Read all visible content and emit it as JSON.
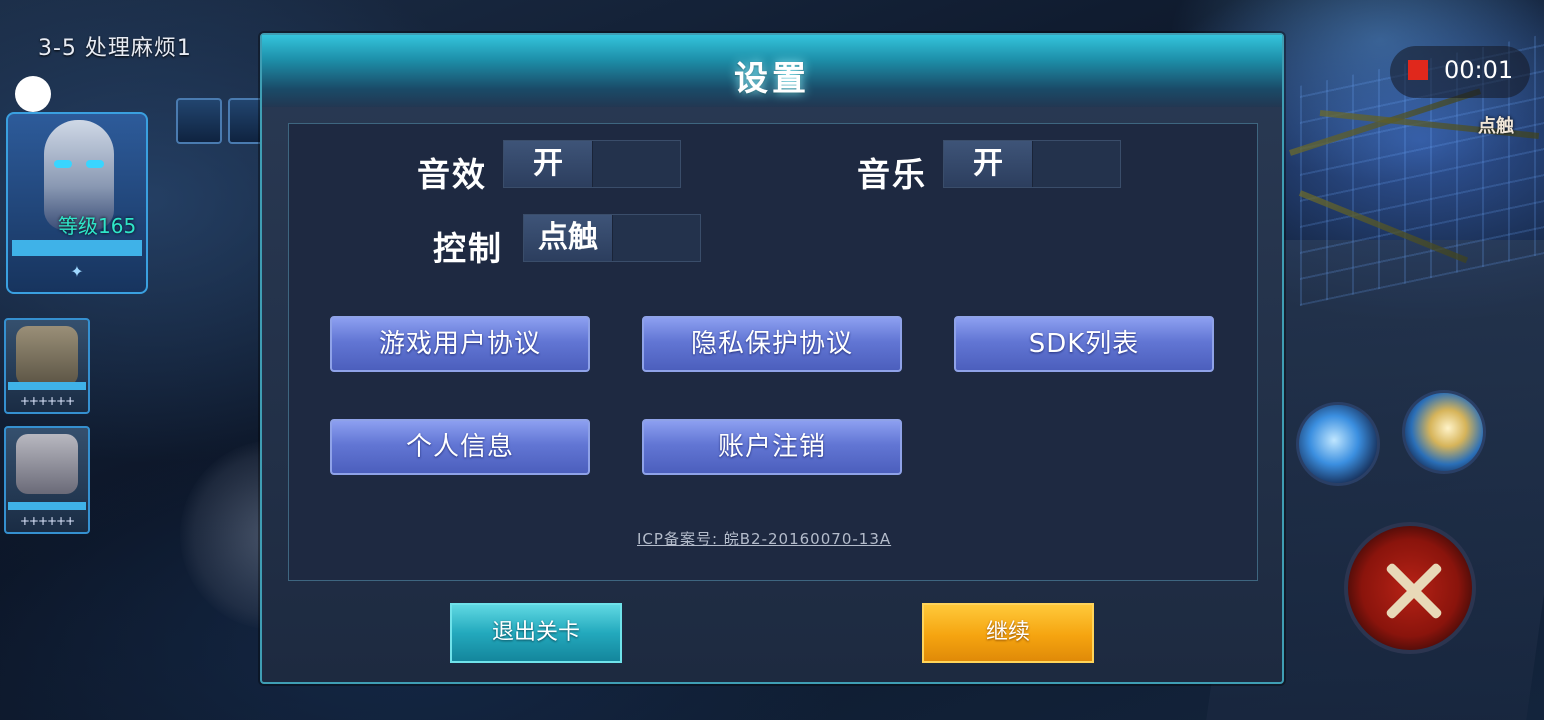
{
  "hud": {
    "stage_label": "3-5 处理麻烦1",
    "hero_level": "等级165",
    "hero_star": "✦",
    "pet1_stars": "++++++",
    "pet2_stars": "++++++",
    "record_time": "00:01",
    "tap_tag": "点触",
    "record_color": "#e0281c"
  },
  "settings": {
    "title": "设置",
    "sound_effects_label": "音效",
    "sound_effects_value": "开",
    "music_label": "音乐",
    "music_value": "开",
    "control_label": "控制",
    "control_value": "点触",
    "buttons": {
      "user_agreement": "游戏用户协议",
      "privacy_agreement": "隐私保护协议",
      "sdk_list": "SDK列表",
      "personal_info": "个人信息",
      "account_cancel": "账户注销"
    },
    "icp_text": "ICP备案号: 皖B2-20160070-13A",
    "exit_label": "退出关卡",
    "continue_label": "继续"
  }
}
